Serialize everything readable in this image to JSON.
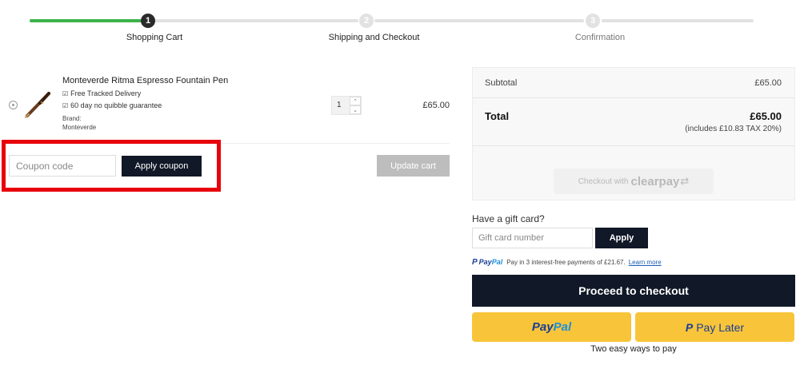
{
  "steps": [
    {
      "number": "1",
      "label": "Shopping Cart"
    },
    {
      "number": "2",
      "label": "Shipping and Checkout"
    },
    {
      "number": "3",
      "label": "Confirmation"
    }
  ],
  "cart": {
    "item": {
      "name": "Monteverde Ritma Espresso Fountain Pen",
      "features": [
        "Free Tracked Delivery",
        "60 day no quibble guarantee"
      ],
      "brand_label": "Brand:",
      "brand_value": "Monteverde",
      "quantity": "1",
      "price": "£65.00"
    },
    "coupon_placeholder": "Coupon code",
    "apply_coupon_label": "Apply coupon",
    "update_cart_label": "Update cart"
  },
  "totals": {
    "subtotal_label": "Subtotal",
    "subtotal_value": "£65.00",
    "total_label": "Total",
    "total_value": "£65.00",
    "tax_note": "(includes £10.83 TAX 20%)",
    "clearpay_text": "Checkout with",
    "clearpay_logo": "clearpay"
  },
  "gift_card": {
    "title": "Have a gift card?",
    "placeholder": "Gift card number",
    "apply_label": "Apply"
  },
  "paypal_message": {
    "brand_pay": "Pay",
    "brand_pal": "Pal",
    "text": "Pay in 3 interest-free payments of £21.67.",
    "learn_more": "Learn more"
  },
  "checkout": {
    "proceed_label": "Proceed to checkout",
    "paypal_pay": "Pay",
    "paypal_pal": "Pal",
    "pay_later_label": "Pay Later",
    "two_ways": "Two easy ways to pay"
  },
  "colors": {
    "progress_done": "#3cb34a",
    "progress_todo": "#e2e2e2",
    "primary_button": "#111827",
    "highlight_border": "#e8000b",
    "paypal_yellow": "#f8c53a",
    "paypal_blue": "#1a3e94"
  },
  "icons": {
    "remove": "remove-item-icon",
    "feature": "check-icon",
    "qty_up": "chevron-up-icon",
    "qty_down": "chevron-down-icon",
    "paypal": "paypal-logo-icon",
    "clearpay": "clearpay-arrow-icon"
  }
}
